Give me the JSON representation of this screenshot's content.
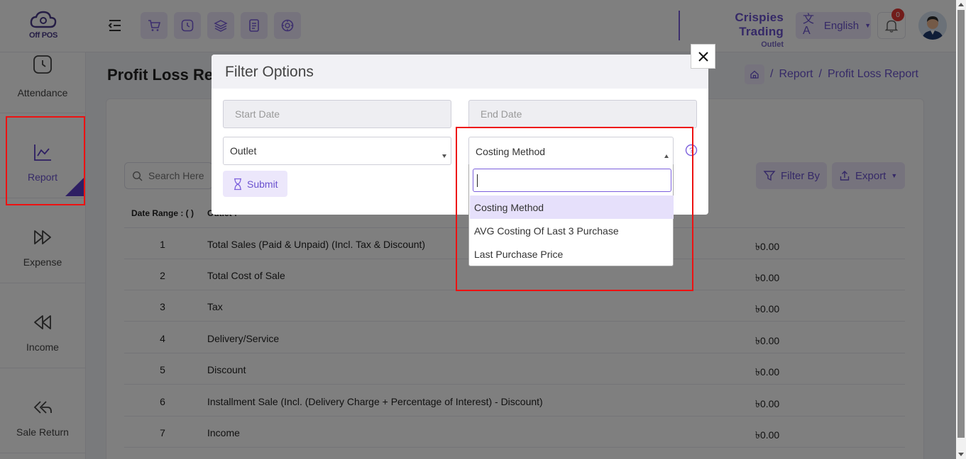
{
  "app": {
    "logo_text": "Off POS",
    "outlet_name": "Crispies Trading",
    "outlet_sub": "Outlet",
    "language": "English",
    "notification_count": "0"
  },
  "sidebar": {
    "items": [
      {
        "label": "Attendance"
      },
      {
        "label": "Report"
      },
      {
        "label": "Expense"
      },
      {
        "label": "Income"
      },
      {
        "label": "Sale Return"
      }
    ]
  },
  "page": {
    "title": "Profit Loss Report",
    "breadcrumb": [
      "Report",
      "Profit Loss Report"
    ],
    "search_placeholder": "Search Here",
    "filter_label": "Filter By",
    "export_label": "Export"
  },
  "table": {
    "date_range_label": "Date Range : ( )",
    "outlet_label": "Outlet :",
    "rows": [
      {
        "sn": "1",
        "desc": "Total Sales (Paid & Unpaid) (Incl. Tax & Discount)",
        "amount": "৳0.00"
      },
      {
        "sn": "2",
        "desc": "Total Cost of Sale",
        "amount": "৳0.00"
      },
      {
        "sn": "3",
        "desc": "Tax",
        "amount": "৳0.00"
      },
      {
        "sn": "4",
        "desc": "Delivery/Service",
        "amount": "৳0.00"
      },
      {
        "sn": "5",
        "desc": "Discount",
        "amount": "৳0.00"
      },
      {
        "sn": "6",
        "desc": "Installment Sale (Incl. (Delivery Charge + Percentage of Interest) - Discount)",
        "amount": "৳0.00"
      },
      {
        "sn": "7",
        "desc": "Income",
        "amount": "৳0.00"
      }
    ]
  },
  "modal": {
    "title": "Filter Options",
    "start_date_placeholder": "Start Date",
    "end_date_placeholder": "End Date",
    "outlet_select": "Outlet",
    "costing_select": "Costing Method",
    "submit_label": "Submit",
    "dropdown_options": [
      "Costing Method",
      "AVG Costing Of Last 3 Purchase",
      "Last Purchase Price"
    ]
  },
  "colors": {
    "accent": "#6b52cf",
    "accent_light": "#ece7fb",
    "highlight_border": "#e11111"
  }
}
